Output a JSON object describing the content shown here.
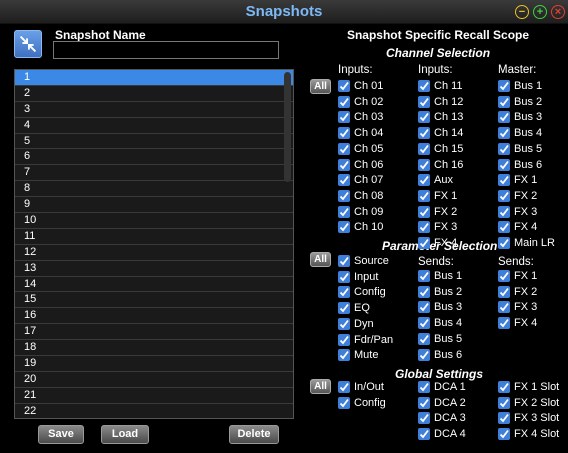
{
  "window": {
    "title": "Snapshots"
  },
  "left": {
    "snapshot_name_label": "Snapshot Name",
    "snapshot_name_value": "",
    "list": [
      "1",
      "2",
      "3",
      "4",
      "5",
      "6",
      "7",
      "8",
      "9",
      "10",
      "11",
      "12",
      "13",
      "14",
      "15",
      "16",
      "17",
      "18",
      "19",
      "20",
      "21",
      "22"
    ],
    "selected_index": 0,
    "buttons": {
      "save": "Save",
      "load": "Load",
      "delete": "Delete"
    }
  },
  "right": {
    "title": "Snapshot Specific Recall Scope",
    "channel": {
      "title": "Channel Selection",
      "all": "All",
      "col_heads": [
        "Inputs:",
        "Inputs:",
        "Master:"
      ],
      "col1": [
        "Ch 01",
        "Ch 02",
        "Ch 03",
        "Ch 04",
        "Ch 05",
        "Ch 06",
        "Ch 07",
        "Ch 08",
        "Ch 09",
        "Ch 10"
      ],
      "col2": [
        "Ch 11",
        "Ch 12",
        "Ch 13",
        "Ch 14",
        "Ch 15",
        "Ch 16",
        "Aux",
        "FX 1",
        "FX 2",
        "FX 3",
        "FX 4"
      ],
      "col3": [
        "Bus 1",
        "Bus 2",
        "Bus 3",
        "Bus 4",
        "Bus 5",
        "Bus 6",
        "FX 1",
        "FX 2",
        "FX 3",
        "FX 4",
        "Main LR"
      ]
    },
    "parameter": {
      "title": "Parameter Selection",
      "all": "All",
      "col_heads": [
        "Sends:",
        "Sends:"
      ],
      "col1": [
        "Source",
        "Input",
        "Config",
        "EQ",
        "Dyn",
        "Fdr/Pan",
        "Mute"
      ],
      "col2": [
        "Bus 1",
        "Bus 2",
        "Bus 3",
        "Bus 4",
        "Bus 5",
        "Bus 6"
      ],
      "col3": [
        "FX 1",
        "FX 2",
        "FX 3",
        "FX 4"
      ]
    },
    "global": {
      "title": "Global Settings",
      "all": "All",
      "col1": [
        "In/Out",
        "Config"
      ],
      "col2": [
        "DCA 1",
        "DCA 2",
        "DCA 3",
        "DCA 4"
      ],
      "col3": [
        "FX 1 Slot",
        "FX 2 Slot",
        "FX 3 Slot",
        "FX 4 Slot"
      ]
    }
  },
  "colors": {
    "accent": "#3c88e6",
    "title": "#7db9f5",
    "checkbox": "#3f7fd8"
  }
}
